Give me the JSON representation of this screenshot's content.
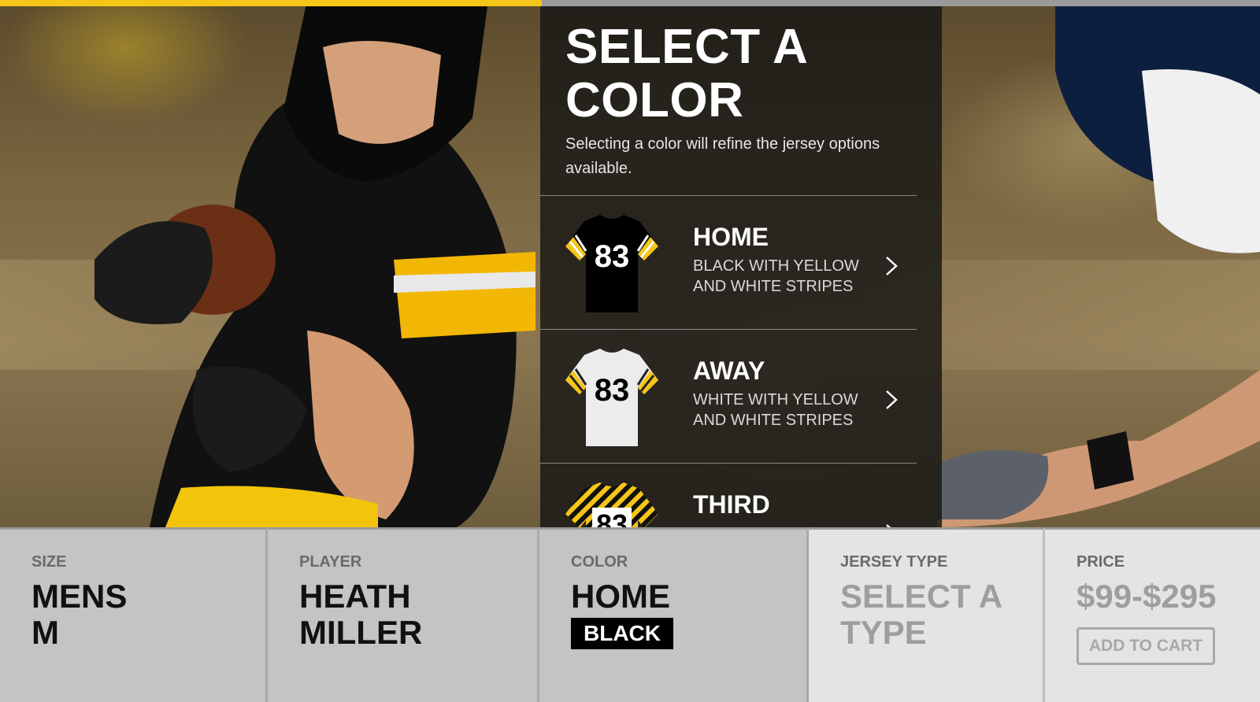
{
  "progress": {
    "fraction": 0.43,
    "fill_color": "#f5c518"
  },
  "panel": {
    "title": "SELECT A COLOR",
    "subtitle": "Selecting a color will refine the jersey options available.",
    "options": [
      {
        "name": "HOME",
        "description": "BLACK WITH YELLOW AND WHITE STRIPES",
        "jersey_number": "83",
        "jersey_color": "#000000",
        "number_color": "#ffffff",
        "icon": "chevron-right-icon"
      },
      {
        "name": "AWAY",
        "description": "WHITE WITH YELLOW AND WHITE STRIPES",
        "jersey_number": "83",
        "jersey_color": "#ececec",
        "number_color": "#000000",
        "icon": "chevron-right-icon"
      },
      {
        "name": "THIRD",
        "description": "",
        "jersey_number": "83",
        "jersey_color": "#f5c518",
        "number_color": "#000000",
        "icon": "chevron-right-icon"
      }
    ]
  },
  "summary": {
    "size": {
      "label": "SIZE",
      "line1": "MENS",
      "line2": "M"
    },
    "player": {
      "label": "PLAYER",
      "line1": "HEATH",
      "line2": "MILLER"
    },
    "color": {
      "label": "COLOR",
      "value": "HOME",
      "badge": "BLACK"
    },
    "jersey_type": {
      "label": "JERSEY TYPE",
      "line1": "SELECT A",
      "line2": "TYPE"
    },
    "price": {
      "label": "PRICE",
      "value": "$99-$295",
      "button": "ADD TO CART"
    }
  },
  "colors": {
    "accent": "#f5c518",
    "panel_bg": "#161616",
    "summary_active": "#c4c4c4",
    "summary_inactive": "#e4e4e4"
  }
}
